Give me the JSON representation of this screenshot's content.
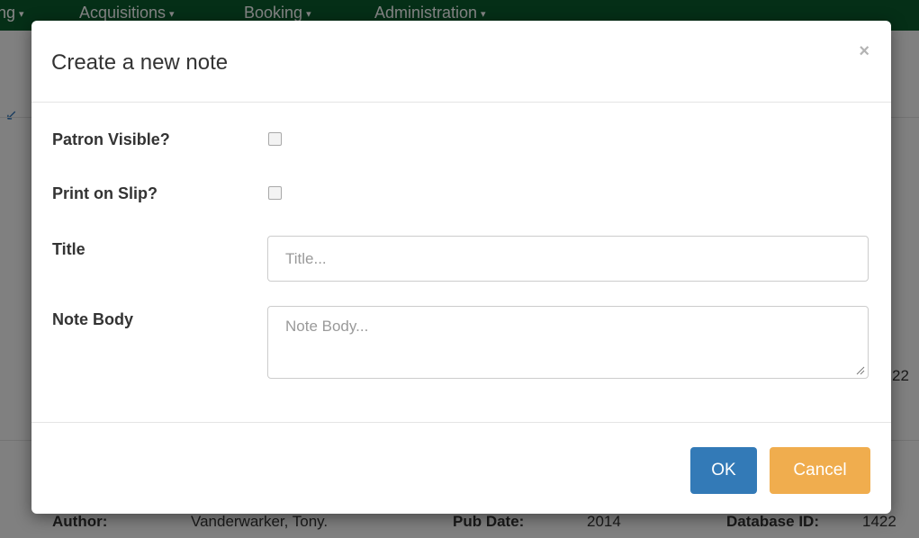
{
  "navbar": {
    "items": [
      {
        "label": "ng",
        "caret": "▾"
      },
      {
        "label": "Acquisitions",
        "caret": "▾"
      },
      {
        "label": "Booking",
        "caret": "▾"
      },
      {
        "label": "Administration",
        "caret": "▾"
      }
    ]
  },
  "background": {
    "author_label": "Author:",
    "author_value": "Vanderwarker, Tony.",
    "pub_date_label": "Pub Date:",
    "pub_date_value": "2014",
    "database_id_label": "Database ID:",
    "database_id_value": "1422",
    "partial_value": "22"
  },
  "modal": {
    "title": "Create a new note",
    "close_symbol": "×",
    "fields": {
      "patron_visible_label": "Patron Visible?",
      "print_on_slip_label": "Print on Slip?",
      "title_label": "Title",
      "title_placeholder": "Title...",
      "title_value": "",
      "note_body_label": "Note Body",
      "note_body_placeholder": "Note Body...",
      "note_body_value": ""
    },
    "buttons": {
      "ok_label": "OK",
      "cancel_label": "Cancel"
    }
  },
  "colors": {
    "navbar": "#0a5a2d",
    "ok_button": "#337ab7",
    "cancel_button": "#f0ad4e"
  }
}
